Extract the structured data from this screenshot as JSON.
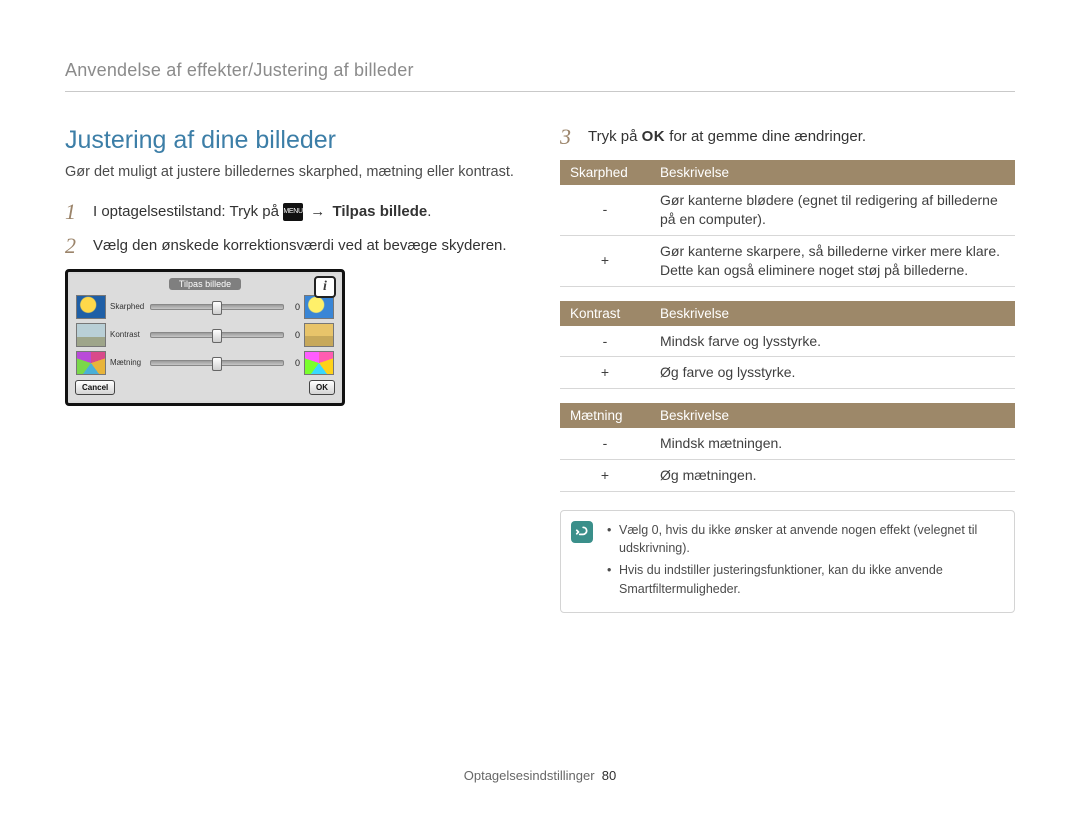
{
  "breadcrumb": "Anvendelse af effekter/Justering af billeder",
  "title": "Justering af dine billeder",
  "intro": "Gør det muligt at justere billedernes skarphed, mætning eller kontrast.",
  "steps": {
    "s1": {
      "num": "1",
      "pre": "I optagelsestilstand: Tryk på",
      "menu": "MENU",
      "arrow": "→",
      "target": "Tilpas billede",
      "suffix": "."
    },
    "s2": {
      "num": "2",
      "text": "Vælg den ønskede korrektionsværdi ved at bevæge skyderen."
    },
    "s3": {
      "num": "3",
      "pre": "Tryk på",
      "ok": "OK",
      "post": "for at gemme dine ændringer."
    }
  },
  "screen": {
    "header": "Tilpas billede",
    "info": "i",
    "rows": [
      {
        "label": "Skarphed",
        "value": "0"
      },
      {
        "label": "Kontrast",
        "value": "0"
      },
      {
        "label": "Mætning",
        "value": "0"
      }
    ],
    "cancel": "Cancel",
    "ok": "OK"
  },
  "tables": {
    "sharpness": {
      "h1": "Skarphed",
      "h2": "Beskrivelse",
      "rows": [
        {
          "sym": "-",
          "desc": "Gør kanterne blødere (egnet til redigering af billederne på en computer)."
        },
        {
          "sym": "+",
          "desc": "Gør kanterne skarpere, så billederne virker mere klare. Dette kan også eliminere noget støj på billederne."
        }
      ]
    },
    "contrast": {
      "h1": "Kontrast",
      "h2": "Beskrivelse",
      "rows": [
        {
          "sym": "-",
          "desc": "Mindsk farve og lysstyrke."
        },
        {
          "sym": "+",
          "desc": "Øg farve og lysstyrke."
        }
      ]
    },
    "saturation": {
      "h1": "Mætning",
      "h2": "Beskrivelse",
      "rows": [
        {
          "sym": "-",
          "desc": "Mindsk mætningen."
        },
        {
          "sym": "+",
          "desc": "Øg mætningen."
        }
      ]
    }
  },
  "note": {
    "items": [
      "Vælg 0, hvis du ikke ønsker at anvende nogen effekt (velegnet til udskrivning).",
      "Hvis du indstiller justeringsfunktioner, kan du ikke anvende Smartfiltermuligheder."
    ]
  },
  "footer": {
    "section": "Optagelsesindstillinger",
    "page": "80"
  }
}
